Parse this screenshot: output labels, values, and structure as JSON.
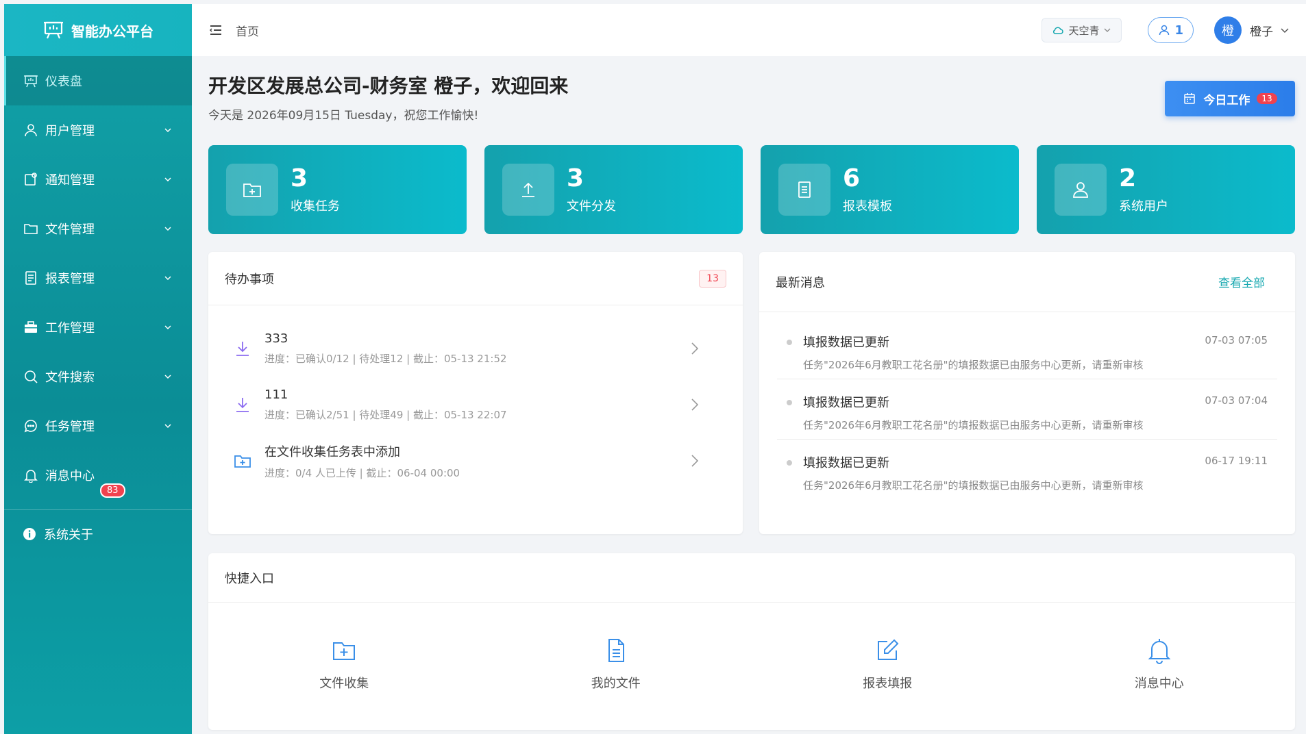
{
  "app": {
    "title": "智能办公平台"
  },
  "sidebar": {
    "items": [
      {
        "label": "仪表盘",
        "icon": "presentation-icon"
      },
      {
        "label": "用户管理",
        "icon": "user-icon"
      },
      {
        "label": "通知管理",
        "icon": "notice-icon"
      },
      {
        "label": "文件管理",
        "icon": "folder-icon"
      },
      {
        "label": "报表管理",
        "icon": "report-icon"
      },
      {
        "label": "工作管理",
        "icon": "briefcase-icon"
      },
      {
        "label": "文件搜索",
        "icon": "search-icon"
      },
      {
        "label": "任务管理",
        "icon": "chat-icon"
      },
      {
        "label": "消息中心",
        "icon": "bell-icon",
        "badge": "83"
      }
    ],
    "about": "系统关于"
  },
  "header": {
    "breadcrumb": "首页",
    "theme": "天空青",
    "online_users": "1",
    "avatar_text": "橙",
    "username": "橙子"
  },
  "welcome": {
    "title": "开发区发展总公司-财务室 橙子，欢迎回来",
    "subtitle": "今天是 2026年09月15日 Tuesday，祝您工作愉快!"
  },
  "today_work": {
    "label": "今日工作",
    "badge": "13"
  },
  "stats": [
    {
      "value": "3",
      "label": "收集任务",
      "icon": "folder-plus-icon"
    },
    {
      "value": "3",
      "label": "文件分发",
      "icon": "upload-icon"
    },
    {
      "value": "6",
      "label": "报表模板",
      "icon": "document-icon"
    },
    {
      "value": "2",
      "label": "系统用户",
      "icon": "user-icon"
    }
  ],
  "todo": {
    "title": "待办事项",
    "count": "13",
    "items": [
      {
        "title": "333",
        "meta": "进度：已确认0/12 | 待处理12 | 截止：05-13 21:52",
        "icon": "download-icon"
      },
      {
        "title": "111",
        "meta": "进度：已确认2/51 | 待处理49 | 截止：05-13 22:07",
        "icon": "download-icon"
      },
      {
        "title": "在文件收集任务表中添加",
        "meta": "进度：0/4 人已上传 | 截止：06-04 00:00",
        "icon": "folder-plus-icon"
      }
    ]
  },
  "news": {
    "title": "最新消息",
    "view_all": "查看全部",
    "items": [
      {
        "title": "填报数据已更新",
        "desc": "任务\"2026年6月教职工花名册\"的填报数据已由服务中心更新，请重新审核",
        "time": "07-03 07:05"
      },
      {
        "title": "填报数据已更新",
        "desc": "任务\"2026年6月教职工花名册\"的填报数据已由服务中心更新，请重新审核",
        "time": "07-03 07:04"
      },
      {
        "title": "填报数据已更新",
        "desc": "任务\"2026年6月教职工花名册\"的填报数据已由服务中心更新，请重新审核",
        "time": "06-17 19:11"
      }
    ]
  },
  "quick": {
    "title": "快捷入口",
    "items": [
      {
        "label": "文件收集",
        "icon": "folder-plus-icon"
      },
      {
        "label": "我的文件",
        "icon": "document-icon"
      },
      {
        "label": "报表填报",
        "icon": "edit-icon"
      },
      {
        "label": "消息中心",
        "icon": "bell-icon"
      }
    ]
  },
  "colors": {
    "brand": "#12a3a9",
    "accent": "#2b7de9",
    "badge": "#f0424f"
  }
}
